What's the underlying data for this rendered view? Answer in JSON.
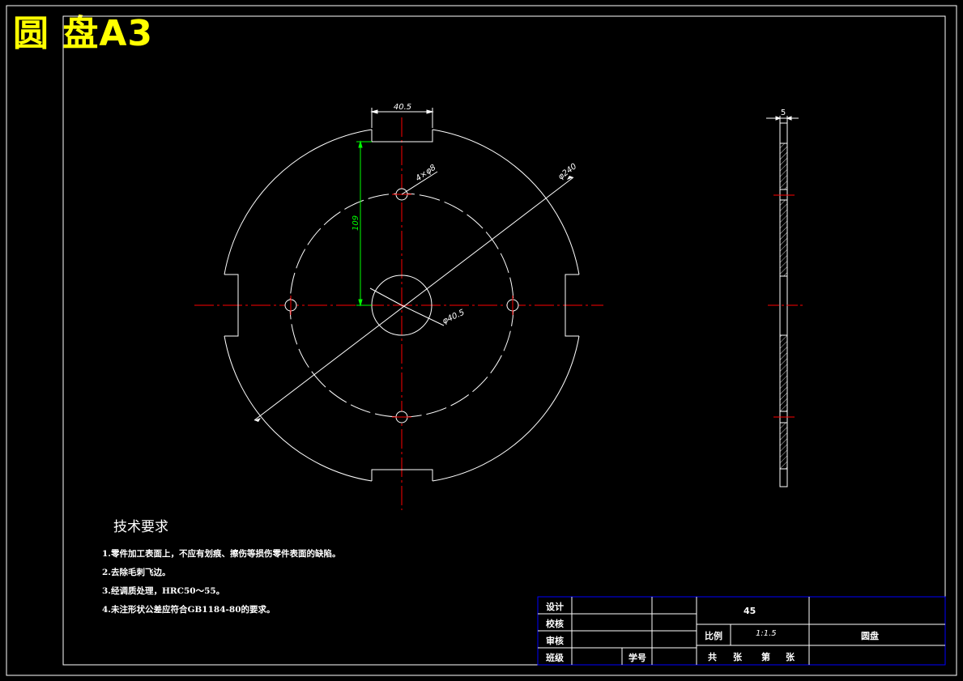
{
  "drawing_title": "圆 盘A3",
  "dimensions": {
    "slot_width": "40.5",
    "hole_pattern": "4×φ8",
    "outer_diameter": "φ240",
    "center_bore": "φ40.5",
    "pitch_radius": "109",
    "thickness": "5"
  },
  "tech_requirements": {
    "heading": "技术要求",
    "items": [
      "1.零件加工表面上，不应有划痕、擦伤等损伤零件表面的缺陷。",
      "2.去除毛刺飞边。",
      "3.经调质处理，HRC50～55。",
      "4.未注形状公差应符合GB1184-80的要求。"
    ]
  },
  "title_block": {
    "design": "设计",
    "check": "校核",
    "review": "审核",
    "class": "班级",
    "student_no": "学号",
    "material": "45",
    "scale_label": "比例",
    "scale_value": "1:1.5",
    "part_name": "圆盘",
    "sheets_total": "共",
    "sheets_unit": "张",
    "sheet_no": "第",
    "sheet_no_unit": "张"
  },
  "colors": {
    "background": "#000000",
    "outline": "#ffffff",
    "centerline": "#ff0000",
    "dimension_highlight": "#00ff00",
    "title": "#ffff00",
    "title_block_frame": "#0000ff"
  }
}
